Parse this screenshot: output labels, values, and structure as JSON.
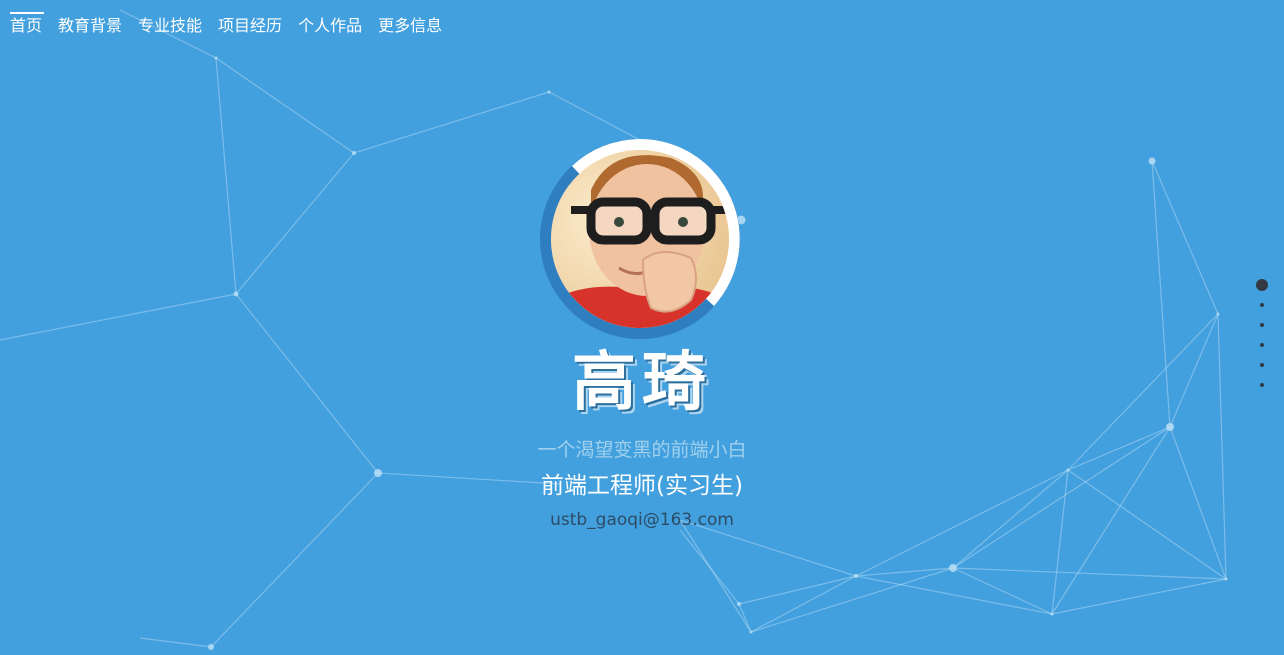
{
  "colors": {
    "background": "#43a0de",
    "text_primary": "#ffffff",
    "text_muted": "#9fd0ee",
    "email_text": "#2d4c66",
    "ring": "#2f7fc0",
    "dot": "#2f3a45"
  },
  "nav": {
    "items": [
      {
        "label": "首页",
        "active": true
      },
      {
        "label": "教育背景",
        "active": false
      },
      {
        "label": "专业技能",
        "active": false
      },
      {
        "label": "项目经历",
        "active": false
      },
      {
        "label": "个人作品",
        "active": false
      },
      {
        "label": "更多信息",
        "active": false
      }
    ]
  },
  "profile": {
    "name": "高琦",
    "tagline": "一个渴望变黑的前端小白",
    "role": "前端工程师(实习生)",
    "email": "ustb_gaoqi@163.com",
    "avatar_icon": "child-with-glasses-avatar"
  },
  "pager": {
    "count": 6,
    "active_index": 0
  }
}
